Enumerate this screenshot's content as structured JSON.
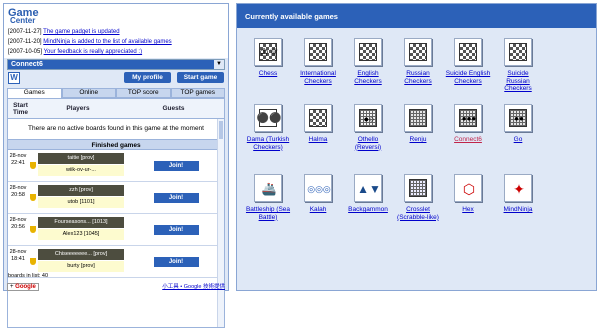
{
  "left": {
    "title": "Game",
    "title2": "Center",
    "news": [
      {
        "date": "[2007-11-27]",
        "text": "The game padget is updated"
      },
      {
        "date": "[2007-11-20]",
        "text": "MindNinja is added to the list of available games"
      },
      {
        "date": "[2007-10-05]",
        "text": "Your feedback is really appreciated :)"
      }
    ],
    "selected_game": "Connect6",
    "buttons": {
      "profile": "My profile",
      "start": "Start game"
    },
    "tabs": [
      "Games",
      "Online",
      "TOP score",
      "TOP games"
    ],
    "columns": {
      "start": "Start Time",
      "players": "Players",
      "guests": "Guests"
    },
    "no_active": "There are no active boards found in this game at the moment",
    "finished_title": "Finished games",
    "rows": [
      {
        "date": "28-nov",
        "time": "22:41",
        "p1": "taitie [prov]",
        "p2": "wiik-ov-ur-...",
        "p2b": "[prov]",
        "join": "Join!"
      },
      {
        "date": "28-nov",
        "time": "20:58",
        "p1": "zzh [prov]",
        "p2": "utob [1101]",
        "p2b": "",
        "join": "Join!"
      },
      {
        "date": "28-nov",
        "time": "20:56",
        "p1": "Fourseasons... [1013]",
        "p2": "Alex123 [1045]",
        "p2b": "",
        "join": "Join!"
      },
      {
        "date": "28-nov",
        "time": "18:41",
        "p1": "Chiseeeeeee... [prov]",
        "p2": "burty [prov]",
        "p2b": "",
        "join": "Join!"
      }
    ],
    "boards_in_list": "boards in list: 40",
    "google_badge": "Google",
    "footer_text": "小工具 • Google 技術提供"
  },
  "right": {
    "title": "Currently available games",
    "games": [
      {
        "name": "Chess",
        "icon": "chess-icon",
        "red": false
      },
      {
        "name": "International Checkers",
        "icon": "checkers-board-icon",
        "red": false
      },
      {
        "name": "English Checkers",
        "icon": "checkers-board-icon",
        "red": false
      },
      {
        "name": "Russian Checkers",
        "icon": "checkers-board-icon",
        "red": false
      },
      {
        "name": "Suicide English Checkers",
        "icon": "checkers-board-icon",
        "red": false
      },
      {
        "name": "Suicide Russian Checkers",
        "icon": "checkers-board-icon",
        "red": false
      },
      {
        "name": "Dama (Turkish Checkers)",
        "icon": "dama-icon",
        "red": false
      },
      {
        "name": "Halma",
        "icon": "halma-icon",
        "red": false
      },
      {
        "name": "Othello (Reversi)",
        "icon": "othello-icon",
        "red": false
      },
      {
        "name": "Renju",
        "icon": "renju-icon",
        "red": false
      },
      {
        "name": "Connect6",
        "icon": "connect6-icon",
        "red": true
      },
      {
        "name": "Go",
        "icon": "go-icon",
        "red": false
      },
      {
        "name": "Battleship (Sea Battle)",
        "icon": "battleship-icon",
        "red": false
      },
      {
        "name": "Kalah",
        "icon": "kalah-icon",
        "red": false
      },
      {
        "name": "Backgammon",
        "icon": "backgammon-icon",
        "red": false
      },
      {
        "name": "Crosslet (Scrabble-like)",
        "icon": "crosslet-icon",
        "red": false
      },
      {
        "name": "Hex",
        "icon": "hex-icon",
        "red": false
      },
      {
        "name": "MindNinja",
        "icon": "mindninja-icon",
        "red": false
      }
    ]
  }
}
